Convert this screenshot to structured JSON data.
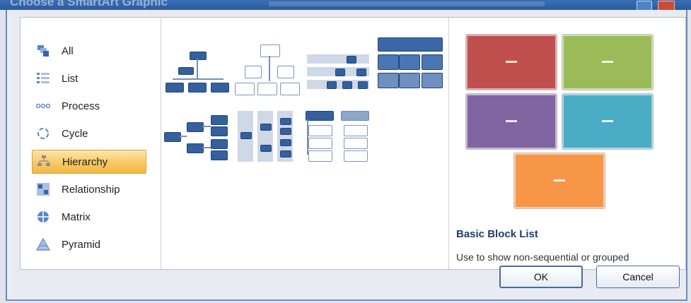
{
  "window": {
    "title": "Choose a SmartArt Graphic"
  },
  "categories": [
    {
      "label": "All",
      "icon": "all-icon"
    },
    {
      "label": "List",
      "icon": "list-icon"
    },
    {
      "label": "Process",
      "icon": "process-icon"
    },
    {
      "label": "Cycle",
      "icon": "cycle-icon"
    },
    {
      "label": "Hierarchy",
      "icon": "hierarchy-icon",
      "selected": true
    },
    {
      "label": "Relationship",
      "icon": "relationship-icon"
    },
    {
      "label": "Matrix",
      "icon": "matrix-icon"
    },
    {
      "label": "Pyramid",
      "icon": "pyramid-icon"
    }
  ],
  "gallery": {
    "layouts": [
      "organization-chart",
      "name-and-title-org-chart",
      "hierarchy",
      "labeled-hierarchy",
      "horizontal-hierarchy",
      "table-hierarchy",
      "hierarchy-list",
      "lined-list"
    ]
  },
  "preview": {
    "title": "Basic Block List",
    "description": "Use to show non-sequential or grouped",
    "block_colors": [
      "#c0504d",
      "#9bbb59",
      "#8064a2",
      "#4bacc6",
      "#f79646"
    ],
    "block_text": "—"
  },
  "buttons": {
    "ok": "OK",
    "cancel": "Cancel"
  }
}
